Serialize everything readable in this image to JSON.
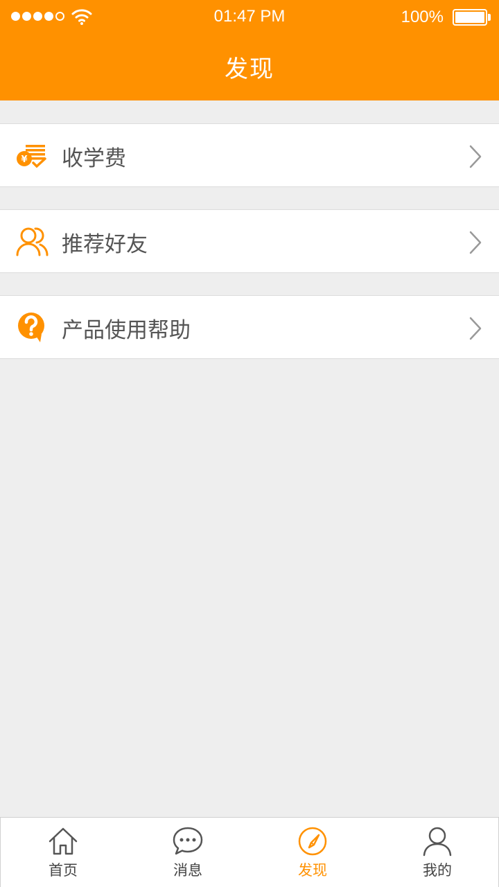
{
  "status_bar": {
    "time": "01:47 PM",
    "battery": "100%"
  },
  "header": {
    "title": "发现"
  },
  "menu": {
    "items": [
      {
        "label": "收学费",
        "icon": "tuition-fee-icon"
      },
      {
        "label": "推荐好友",
        "icon": "friends-icon"
      },
      {
        "label": "产品使用帮助",
        "icon": "help-icon"
      }
    ]
  },
  "tabbar": {
    "tabs": [
      {
        "label": "首页",
        "icon": "home-icon"
      },
      {
        "label": "消息",
        "icon": "message-icon"
      },
      {
        "label": "发现",
        "icon": "compass-icon",
        "active": true
      },
      {
        "label": "我的",
        "icon": "person-icon"
      }
    ]
  },
  "colors": {
    "accent": "#ff9100",
    "background": "#eeeeee",
    "text": "#555555"
  }
}
